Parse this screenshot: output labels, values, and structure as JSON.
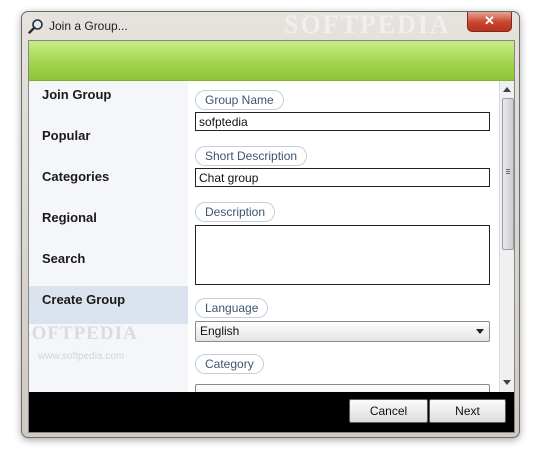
{
  "window": {
    "title": "Join a Group...",
    "close_glyph": "✕",
    "watermark": "SOFTPEDIA"
  },
  "sidebar": {
    "items": [
      {
        "label": "Join Group",
        "active": false
      },
      {
        "label": "Popular",
        "active": false
      },
      {
        "label": "Categories",
        "active": false
      },
      {
        "label": "Regional",
        "active": false
      },
      {
        "label": "Search",
        "active": false
      },
      {
        "label": "Create Group",
        "active": true
      }
    ],
    "watermark": "SOFTPEDIA",
    "watermark_url": "www.softpedia.com"
  },
  "form": {
    "group_name_label": "Group Name",
    "group_name_value": "sofptedia",
    "short_description_label": "Short Description",
    "short_description_value": "Chat group",
    "description_label": "Description",
    "description_value": "",
    "language_label": "Language",
    "language_value": "English",
    "category_label": "Category"
  },
  "footer": {
    "cancel_label": "Cancel",
    "next_label": "Next"
  },
  "colors": {
    "banner": "#9fd24a",
    "close_button": "#c9442c",
    "footer": "#000000"
  }
}
